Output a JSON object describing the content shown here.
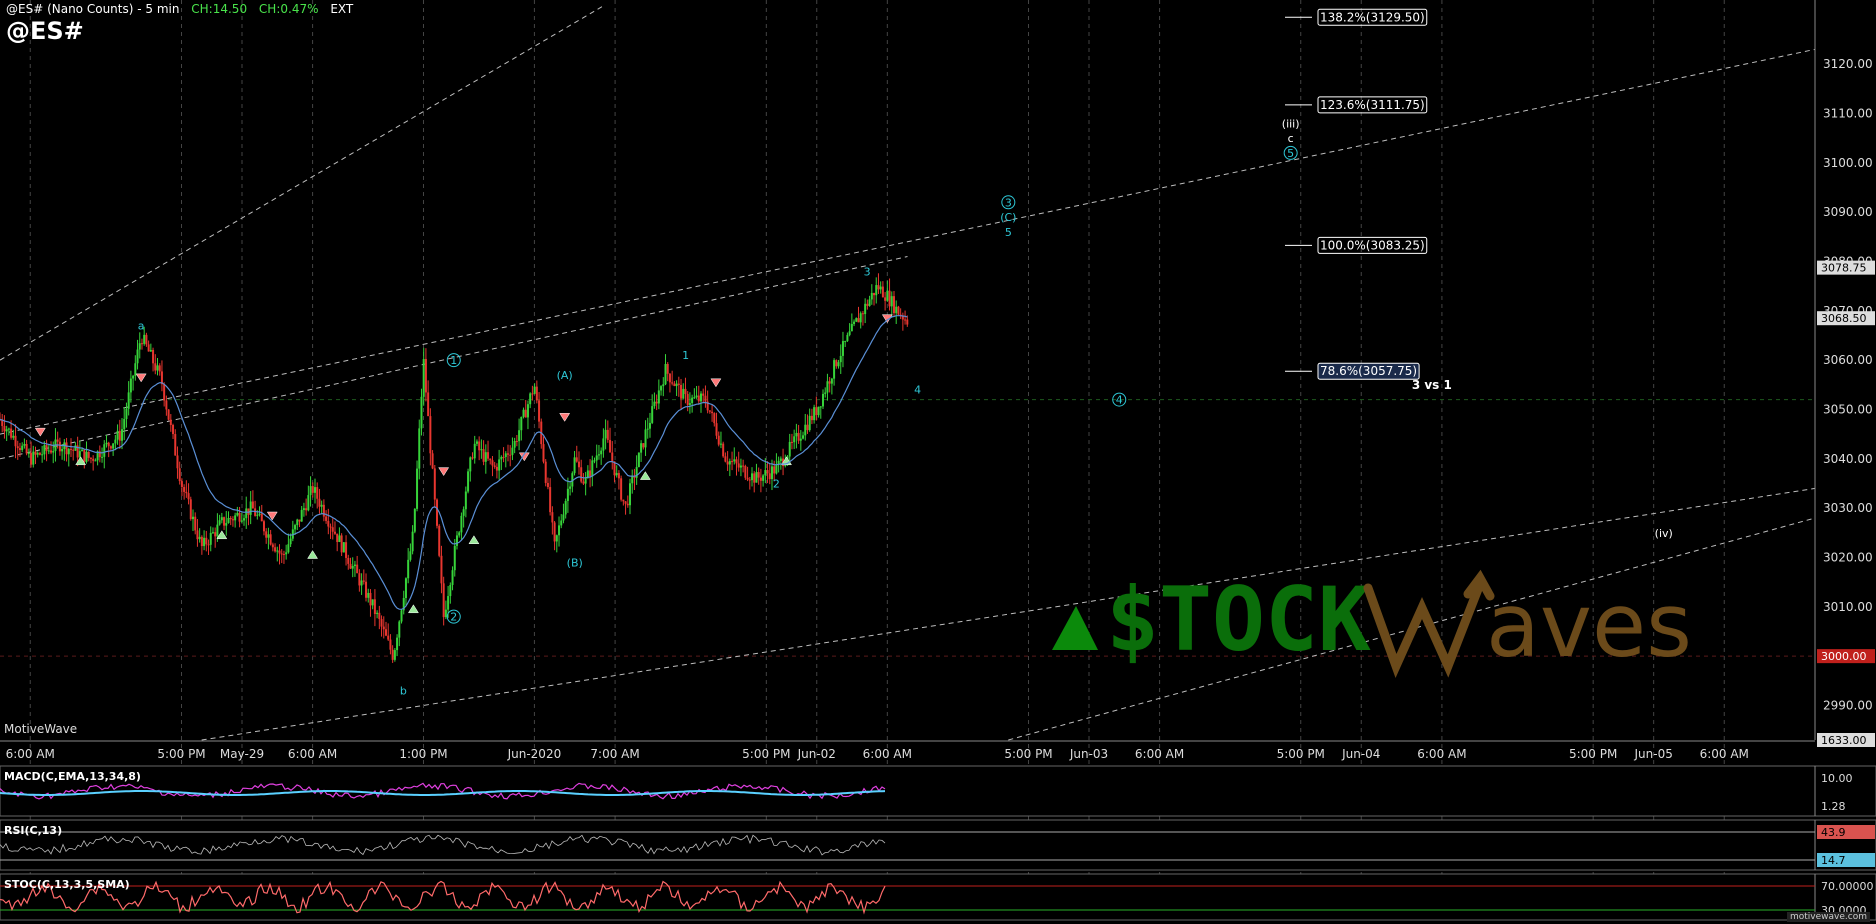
{
  "header": {
    "title": "@ES# (Nano Counts) - 5 min",
    "ch_points": "CH:14.50",
    "ch_pct": "CH:0.47%",
    "session": "EXT",
    "symbol": "@ES#"
  },
  "watermark": {
    "brand": "MotiveWave",
    "brand_small": "motivewave.com"
  },
  "logo": {
    "text_left": "$TOCK",
    "text_right": "aves",
    "accent_green": "#0b8a0b",
    "accent_brown": "#6b4a1a"
  },
  "colors": {
    "background": "#000000",
    "candle_up": "#37d43a",
    "candle_down": "#e8362f",
    "ma_line": "#5a8fd6",
    "wave_label": "#2ec7d6",
    "grid": "#3a3a3a",
    "trend_line": "#bdbdbd"
  },
  "chart_data": [
    {
      "type": "line",
      "title": "@ES# (Nano Counts) - 5 min",
      "ylim": [
        2983,
        3133
      ],
      "y_ticks": [
        2990,
        3000,
        3010,
        3020,
        3030,
        3040,
        3050,
        3060,
        3070,
        3080,
        3090,
        3100,
        3110,
        3120
      ],
      "y_tick_labels": [
        "2990.00",
        "3000.00",
        "3010.00",
        "3020.00",
        "3030.00",
        "3040.00",
        "3050.00",
        "3060.00",
        "3070.00",
        "3080.00",
        "3090.00",
        "3100.00",
        "3110.00",
        "3120.00"
      ],
      "x_tick_labels": [
        "6:00 AM",
        "5:00 PM",
        "May-29",
        "6:00 AM",
        "1:00 PM",
        "Jun-2020",
        "7:00 AM",
        "5:00 PM",
        "Jun-02",
        "6:00 AM",
        "5:00 PM",
        "Jun-03",
        "6:00 AM",
        "5:00 PM",
        "Jun-04",
        "6:00 AM",
        "5:00 PM",
        "Jun-05",
        "6:00 AM"
      ],
      "x_range": [
        0,
        120
      ],
      "x_tick_positions": [
        3,
        18,
        24,
        31,
        42,
        53,
        61,
        76,
        81,
        88,
        102,
        108,
        115,
        129,
        135,
        143,
        158,
        164,
        171
      ],
      "price_path_x": [
        0,
        3,
        6,
        9,
        12,
        14,
        16,
        18,
        20,
        22,
        25,
        28,
        31,
        34,
        37,
        39,
        41,
        42,
        44,
        45,
        47,
        49,
        51,
        53,
        55,
        57,
        58,
        60,
        62,
        64,
        66,
        68,
        70,
        72,
        75,
        77,
        79,
        81,
        83,
        85,
        87,
        88,
        89,
        90
      ],
      "price_path_y": [
        3048,
        3040,
        3043,
        3040,
        3045,
        3065,
        3056,
        3035,
        3022,
        3027,
        3030,
        3020,
        3034,
        3022,
        3010,
        3000,
        3025,
        3060,
        3008,
        3020,
        3043,
        3038,
        3043,
        3055,
        3022,
        3040,
        3035,
        3045,
        3030,
        3045,
        3058,
        3052,
        3052,
        3040,
        3036,
        3038,
        3044,
        3050,
        3060,
        3068,
        3075,
        3073,
        3070,
        3068
      ],
      "price_labels": [
        {
          "text": "3078.75",
          "value": 3078.75
        },
        {
          "text": "3068.50",
          "value": 3068.5
        },
        {
          "text": "3000.00",
          "value": 3000.0
        },
        {
          "text": "1633.00",
          "value": 2983.0
        }
      ],
      "fib_levels": [
        {
          "text": "138.2%(3129.50)",
          "value": 3129.5
        },
        {
          "text": "123.6%(3111.75)",
          "value": 3111.75
        },
        {
          "text": "100.0%(3083.25)",
          "value": 3083.25
        },
        {
          "text": "78.6%(3057.75)",
          "value": 3057.75
        }
      ],
      "annotations": [
        {
          "text": "3 vs 1",
          "x": 142,
          "y": 3055
        },
        {
          "text": "a",
          "x": 14,
          "y": 3067
        },
        {
          "text": "b",
          "x": 40,
          "y": 2993
        },
        {
          "text": "1",
          "x": 45,
          "y": 3060,
          "circled": true
        },
        {
          "text": "2",
          "x": 45,
          "y": 3008,
          "circled": true
        },
        {
          "text": "(A)",
          "x": 56,
          "y": 3057
        },
        {
          "text": "(B)",
          "x": 57,
          "y": 3019
        },
        {
          "text": "1",
          "x": 68,
          "y": 3061
        },
        {
          "text": "2",
          "x": 77,
          "y": 3035
        },
        {
          "text": "3",
          "x": 86,
          "y": 3078
        },
        {
          "text": "4",
          "x": 91,
          "y": 3054
        },
        {
          "text": "3",
          "x": 100,
          "y": 3092,
          "circled": true
        },
        {
          "text": "(C)",
          "x": 100,
          "y": 3089
        },
        {
          "text": "5",
          "x": 100,
          "y": 3086
        },
        {
          "text": "4",
          "x": 111,
          "y": 3052,
          "circled": true
        },
        {
          "text": "(iii)",
          "x": 128,
          "y": 3108
        },
        {
          "text": "c",
          "x": 128,
          "y": 3105
        },
        {
          "text": "5",
          "x": 128,
          "y": 3102,
          "circled": true
        },
        {
          "text": "(iv)",
          "x": 165,
          "y": 3025
        }
      ]
    },
    {
      "type": "line",
      "title": "MACD(C,EMA,13,34,8)",
      "value_labels": [
        {
          "text": "10.00",
          "value": 10.0
        },
        {
          "text": "1.28",
          "value": 1.28
        }
      ]
    },
    {
      "type": "line",
      "title": "RSI(C,13)",
      "value_labels": [
        {
          "text": "43.9",
          "value": 43.9
        },
        {
          "text": "14.7",
          "value": 14.7
        }
      ]
    },
    {
      "type": "line",
      "title": "STOC(C,13,3,5,SMA)",
      "value_labels": [
        {
          "text": "70.00000",
          "value": 70.0
        },
        {
          "text": "30.0000",
          "value": 30.0
        }
      ]
    }
  ]
}
